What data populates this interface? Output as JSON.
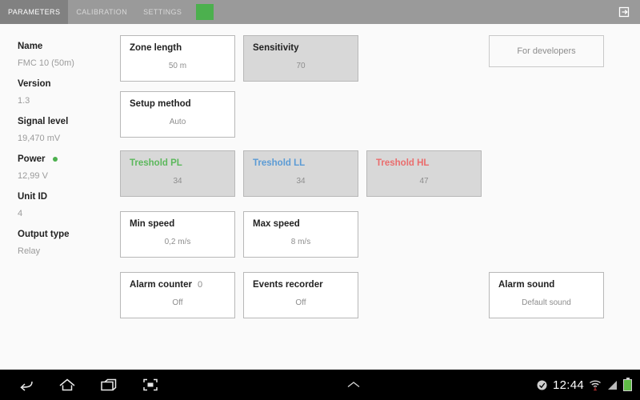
{
  "topbar": {
    "tabs": [
      {
        "label": "PARAMETERS",
        "active": true
      },
      {
        "label": "CALIBRATION",
        "active": false
      },
      {
        "label": "SETTINGS",
        "active": false
      }
    ],
    "status_chip_color": "#4cb04e",
    "exit_icon": "exit-icon"
  },
  "sidebar": {
    "items": [
      {
        "label": "Name",
        "value": "FMC 10 (50m)"
      },
      {
        "label": "Version",
        "value": "1.3"
      },
      {
        "label": "Signal level",
        "value": "19,470 mV"
      },
      {
        "label": "Power",
        "value": "12,99 V",
        "dot": "#4cb04e"
      },
      {
        "label": "Unit ID",
        "value": "4"
      },
      {
        "label": "Output type",
        "value": "Relay"
      }
    ]
  },
  "cards": [
    {
      "title": "Zone length",
      "value": "50 m",
      "filled": false,
      "accent": ""
    },
    {
      "title": "Sensitivity",
      "value": "70",
      "filled": true,
      "accent": ""
    },
    {
      "title": "Setup method",
      "value": "Auto",
      "filled": false,
      "accent": ""
    },
    {
      "title": "Treshold PL",
      "value": "34",
      "filled": true,
      "accent": "t-green"
    },
    {
      "title": "Treshold LL",
      "value": "34",
      "filled": true,
      "accent": "t-blue"
    },
    {
      "title": "Treshold HL",
      "value": "47",
      "filled": true,
      "accent": "t-red"
    },
    {
      "title": "Min speed",
      "value": "0,2 m/s",
      "filled": false,
      "accent": ""
    },
    {
      "title": "Max speed",
      "value": "8 m/s",
      "filled": false,
      "accent": ""
    },
    {
      "title": "Alarm counter",
      "value": "Off",
      "filled": false,
      "accent": "",
      "counter": "0"
    },
    {
      "title": "Events recorder",
      "value": "Off",
      "filled": false,
      "accent": ""
    },
    {
      "title": "Alarm sound",
      "value": "Default sound",
      "filled": false,
      "accent": ""
    }
  ],
  "developers_button": {
    "label": "For developers"
  },
  "navbar": {
    "back_icon": "back-arrow-icon",
    "home_icon": "home-icon",
    "recents_icon": "recent-apps-icon",
    "screenshot_icon": "screen-capture-icon",
    "expand_icon": "chevron-up-icon",
    "clock": "12:44",
    "alarm_icon": "alarm-clock-icon",
    "wifi_icon": "wifi-icon",
    "signal_icon": "cellular-signal-icon",
    "battery_icon": "battery-icon",
    "battery_color": "#5fbb46"
  }
}
